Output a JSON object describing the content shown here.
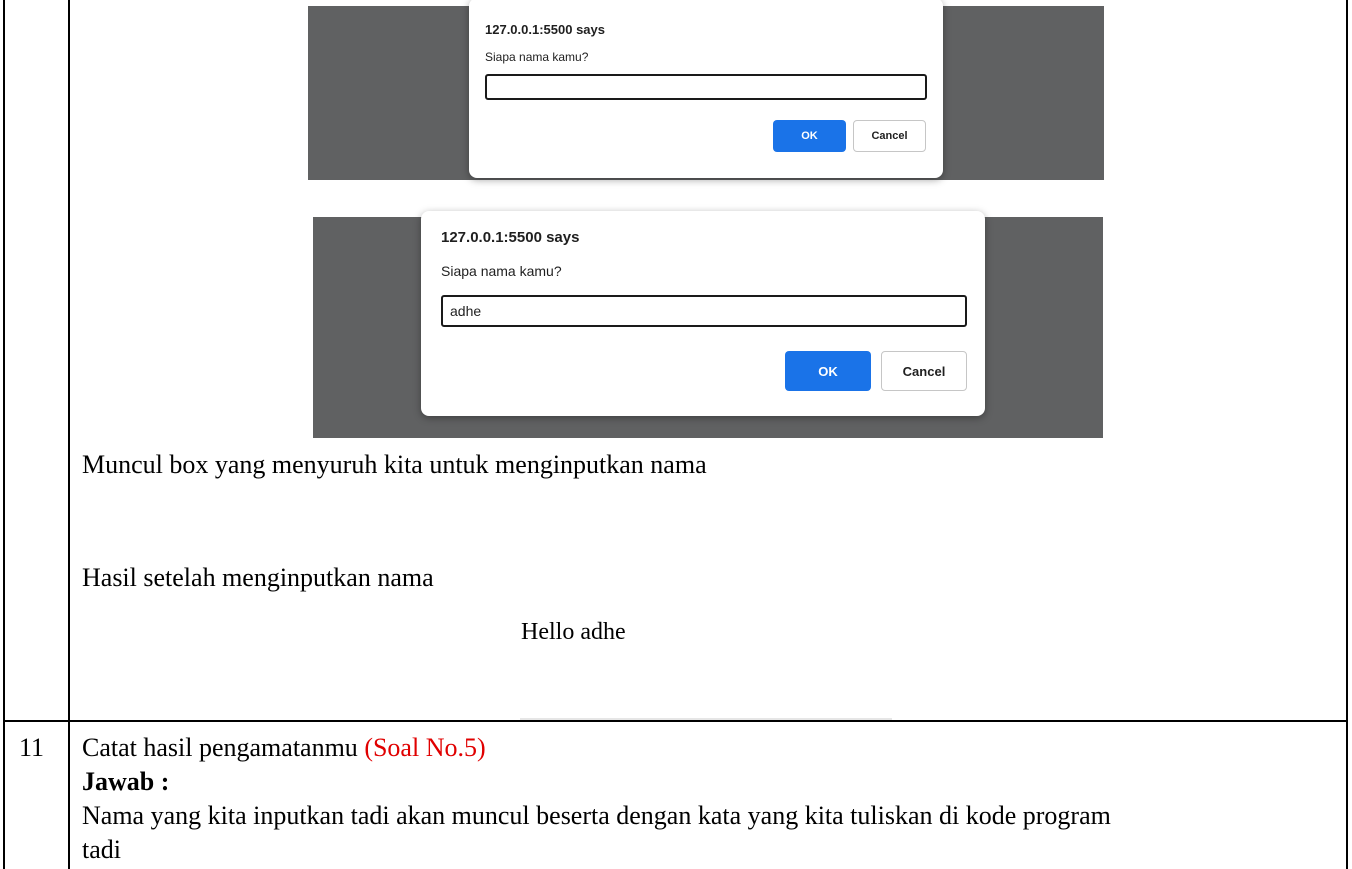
{
  "dialog1": {
    "title": "127.0.0.1:5500 says",
    "message": "Siapa nama kamu?",
    "input_value": "",
    "ok_label": "OK",
    "cancel_label": "Cancel"
  },
  "dialog2": {
    "title": "127.0.0.1:5500 says",
    "message": "Siapa nama kamu?",
    "input_value": "adhe",
    "ok_label": "OK",
    "cancel_label": "Cancel"
  },
  "row10": {
    "caption_prompt": "Muncul box yang menyuruh kita untuk menginputkan nama",
    "caption_result": "Hasil setelah menginputkan nama",
    "result_output": "Hello adhe"
  },
  "row11": {
    "number": "11",
    "instruction": "Catat hasil pengamatanmu",
    "question_ref": "(Soal No.5)",
    "answer_label": "Jawab :",
    "answer_line1": "Nama yang kita inputkan tadi akan muncul beserta dengan kata yang kita tuliskan di kode program",
    "answer_line2": "tadi"
  }
}
